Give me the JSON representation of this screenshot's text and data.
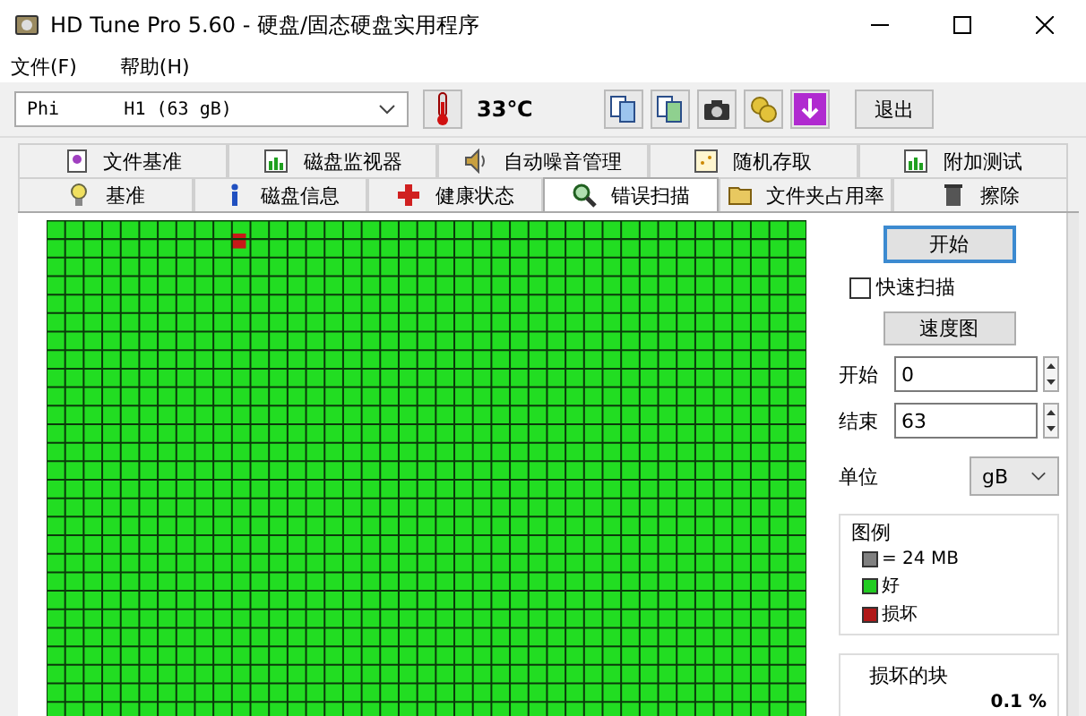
{
  "window": {
    "title": "HD Tune Pro 5.60 - 硬盘/固态硬盘实用程序"
  },
  "menu": [
    "文件(F)",
    "帮助(H)"
  ],
  "toolbar": {
    "drive": "Phi      H1 (63 gB)",
    "temperature": "33℃",
    "exit_button": "退出"
  },
  "tabs_top": [
    {
      "label": "文件基准",
      "selected": false
    },
    {
      "label": "磁盘监视器",
      "selected": false
    },
    {
      "label": "自动噪音管理",
      "selected": false
    },
    {
      "label": "随机存取",
      "selected": false
    },
    {
      "label": "附加测试",
      "selected": false
    }
  ],
  "tabs_bottom": [
    {
      "label": "基准",
      "selected": false
    },
    {
      "label": "磁盘信息",
      "selected": false
    },
    {
      "label": "健康状态",
      "selected": false
    },
    {
      "label": "错误扫描",
      "selected": true
    },
    {
      "label": "文件夹占用率",
      "selected": false
    },
    {
      "label": "擦除",
      "selected": false
    }
  ],
  "panel": {
    "start_button": "开始",
    "quick_scan": {
      "label": "快速扫描",
      "checked": false
    },
    "speed_map_button": "速度图",
    "start": {
      "label": "开始",
      "value": "0"
    },
    "end": {
      "label": "结束",
      "value": "63"
    },
    "unit": {
      "label": "单位",
      "value": "gB"
    },
    "legend": {
      "title": "图例",
      "items": [
        {
          "label": "= 24 MB",
          "color": "#808080"
        },
        {
          "label": "好",
          "color": "#22cc22"
        },
        {
          "label": "损坏",
          "color": "#b01818"
        }
      ]
    },
    "damaged": {
      "title": "损坏的块",
      "value": "0.1 %"
    }
  }
}
